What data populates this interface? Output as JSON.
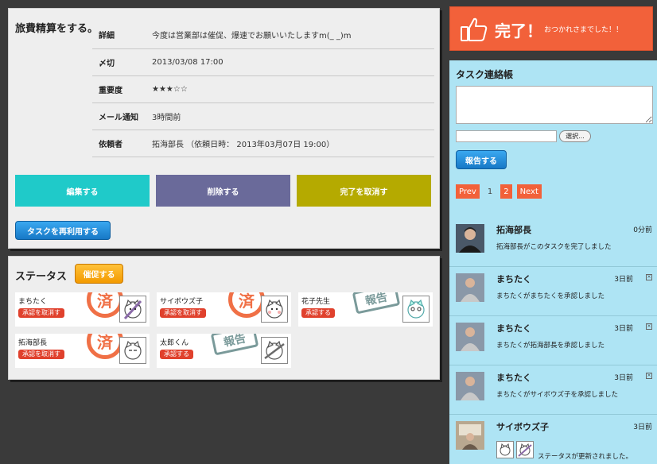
{
  "task": {
    "title": "旅費精算をする。",
    "rows": [
      {
        "label": "詳細",
        "value": "今度は営業部は催促、爆速でお願いいたしますm(_ _)m"
      },
      {
        "label": "〆切",
        "value": "2013/03/08 17:00"
      },
      {
        "label": "重要度",
        "value": "★★★☆☆"
      },
      {
        "label": "メール通知",
        "value": "3時間前"
      },
      {
        "label": "依頼者",
        "value": "拓海部長 （依頼日時： 2013年03月07日 19:00）"
      }
    ],
    "edit_label": "編集する",
    "delete_label": "削除する",
    "undo_complete_label": "完了を取消す",
    "reuse_label": "タスクを再利用する"
  },
  "status": {
    "title": "ステータス",
    "remind_label": "催促する",
    "cards": [
      {
        "name": "まちたく",
        "button": "承認を取消す",
        "stamp": "済"
      },
      {
        "name": "サイボウズ子",
        "button": "承認を取消す",
        "stamp": "済"
      },
      {
        "name": "花子先生",
        "button": "承認する",
        "stamp": "報告"
      },
      {
        "name": "拓海部長",
        "button": "承認を取消す",
        "stamp": "済"
      },
      {
        "name": "太郎くん",
        "button": "承認する",
        "stamp": "報告"
      }
    ]
  },
  "banner": {
    "title": "完了！",
    "message": "おつかれさまでした！！"
  },
  "sidebar": {
    "title": "タスク連絡帳",
    "select_label": "選択...",
    "report_label": "報告する",
    "pager": {
      "prev": "Prev",
      "page1": "1",
      "page2": "2",
      "next": "Next"
    },
    "feed": [
      {
        "name": "拓海部長",
        "time": "0分前",
        "message": "拓海部長がこのタスクを完了しました",
        "closable": false
      },
      {
        "name": "まちたく",
        "time": "3日前",
        "message": "まちたくがまちたくを承認しました",
        "closable": true
      },
      {
        "name": "まちたく",
        "time": "3日前",
        "message": "まちたくが拓海部長を承認しました",
        "closable": true
      },
      {
        "name": "まちたく",
        "time": "3日前",
        "message": "まちたくがサイボウズ子を承認しました",
        "closable": true
      },
      {
        "name": "サイボウズ子",
        "time": "3日前",
        "message": "ステータスが更新されました。",
        "closable": false
      }
    ]
  },
  "colors": {
    "edit": "#1fcac9",
    "delete": "#6a6a9a",
    "undo": "#b5aa00",
    "banner": "#f2613a",
    "sidebar": "#aee4f4"
  }
}
